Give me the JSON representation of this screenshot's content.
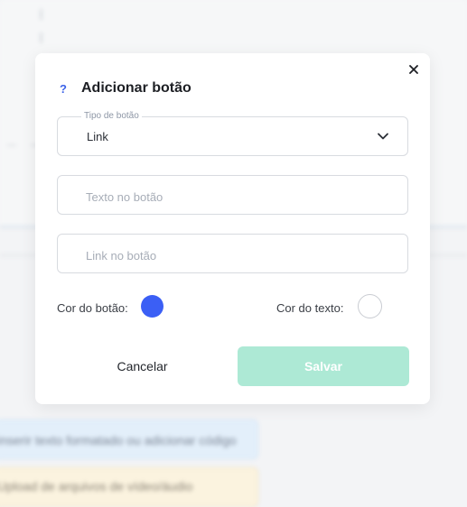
{
  "background": {
    "bar1_text": "inserir texto formatado ou adicionar código",
    "bar2_text": "Upload de arquivos de vídeo/áudio"
  },
  "modal": {
    "title": "Adicionar botão",
    "help_icon": "?",
    "close_icon": "close-icon",
    "button_type": {
      "label": "Tipo de botão",
      "value": "Link"
    },
    "button_text": {
      "placeholder": "Texto no botão",
      "value": ""
    },
    "button_link": {
      "placeholder": "Link no botão",
      "value": ""
    },
    "button_color": {
      "label": "Cor do botão:",
      "color": "#3b5ff5"
    },
    "text_color": {
      "label": "Cor do texto:",
      "color": "#ffffff"
    },
    "cancel_label": "Cancelar",
    "save_label": "Salvar",
    "save_color": "#ade9d5"
  }
}
